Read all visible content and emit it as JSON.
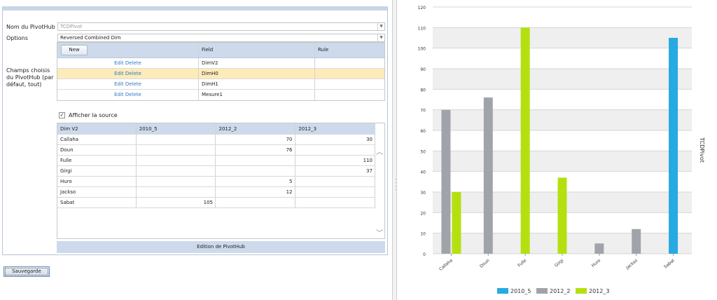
{
  "form": {
    "pivothub_name_label": "Nom du PivotHub",
    "pivothub_name_value": "TCDPivot",
    "options_label": "Options",
    "options_value": "Reversed Combined Dim",
    "fields_label": "Champs choisis du PivotHub (par défaut, tout)"
  },
  "fields_grid": {
    "new_label": "New",
    "headers": [
      "",
      "Field",
      "Rule"
    ],
    "rows": [
      {
        "edit": "Edit",
        "delete": "Delete",
        "field": "DimV2",
        "rule": ""
      },
      {
        "edit": "Edit",
        "delete": "Delete",
        "field": "DimH0",
        "rule": ""
      },
      {
        "edit": "Edit",
        "delete": "Delete",
        "field": "DimH1",
        "rule": ""
      },
      {
        "edit": "Edit",
        "delete": "Delete",
        "field": "Mesure1",
        "rule": ""
      }
    ],
    "selected_row": 1
  },
  "source_checkbox": {
    "label": "Afficher la source",
    "checked": true
  },
  "source_grid": {
    "headers": [
      "Dim V2",
      "2010_5",
      "2012_2",
      "2012_3"
    ],
    "rows": [
      [
        "Callaha",
        "",
        "70",
        "30"
      ],
      [
        "Doun",
        "",
        "76",
        ""
      ],
      [
        "Fulle",
        "",
        "",
        "110"
      ],
      [
        "Girgi",
        "",
        "",
        "37"
      ],
      [
        "Huro",
        "",
        "5",
        ""
      ],
      [
        "Jackso",
        "",
        "12",
        ""
      ],
      [
        "Sabat",
        "105",
        "",
        ""
      ]
    ]
  },
  "footer_label": "Edition de PivotHub",
  "save_button_label": "Sauvegarde",
  "chart_data": {
    "type": "bar",
    "categories": [
      "Callaha",
      "Doun",
      "Fulle",
      "Girgi",
      "Huro",
      "Jackso",
      "Sabat"
    ],
    "series": [
      {
        "name": "2010_5",
        "color": "#27a9e1",
        "values": [
          null,
          null,
          null,
          null,
          null,
          null,
          105
        ]
      },
      {
        "name": "2012_2",
        "color": "#a0a4aa",
        "values": [
          70,
          76,
          null,
          null,
          5,
          12,
          null
        ]
      },
      {
        "name": "2012_3",
        "color": "#b5e00f",
        "values": [
          30,
          null,
          110,
          37,
          null,
          null,
          null
        ]
      }
    ],
    "ylim": [
      0,
      120
    ],
    "yticks": [
      0,
      10,
      20,
      30,
      40,
      50,
      60,
      70,
      80,
      90,
      100,
      110,
      120
    ],
    "y2label": "TCDPivot",
    "legend_position": "bottom",
    "grid": true
  }
}
